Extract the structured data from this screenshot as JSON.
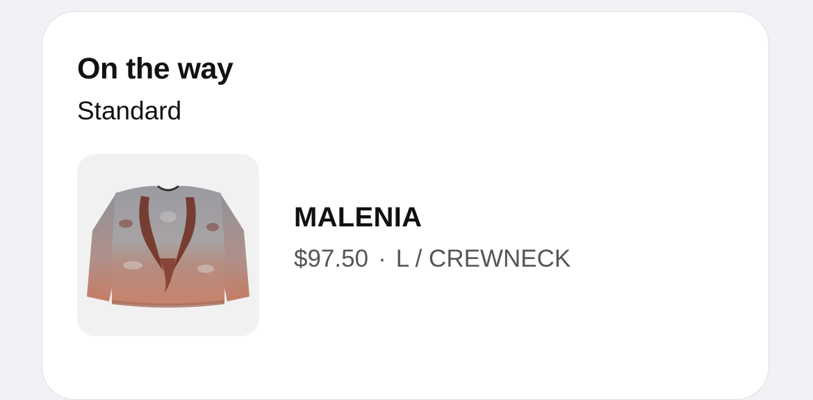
{
  "card": {
    "status": "On the way",
    "shipping_method": "Standard"
  },
  "item": {
    "image_icon": "crewneck-sweater-image",
    "name": "MALENIA",
    "price": "$97.50",
    "separator": "·",
    "variant": "L / CREWNECK"
  },
  "colors": {
    "background": "#f2f2f6",
    "card": "#ffffff",
    "text_primary": "#111111",
    "text_secondary": "#555555",
    "thumb_bg": "#f1f1f1"
  }
}
